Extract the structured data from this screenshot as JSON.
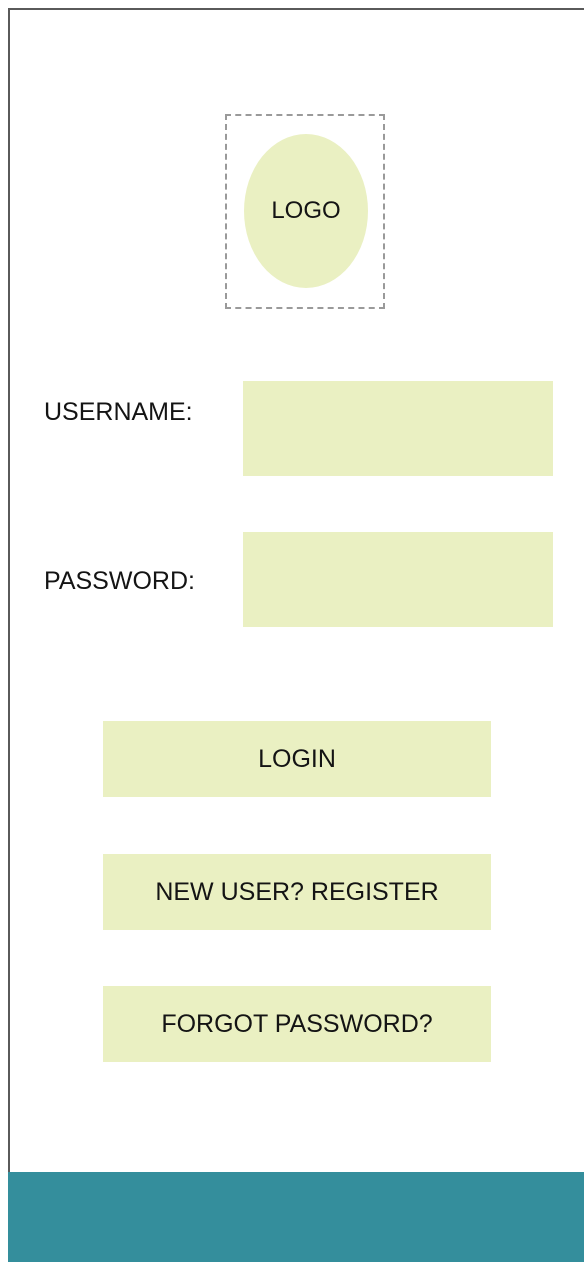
{
  "logo": {
    "text": "LOGO"
  },
  "form": {
    "username_label": "USERNAME:",
    "username_value": "",
    "password_label": "PASSWORD:",
    "password_value": ""
  },
  "actions": {
    "login_label": "LOGIN",
    "register_label": "NEW USER? REGISTER",
    "forgot_label": "FORGOT PASSWORD?"
  },
  "colors": {
    "field_fill": "#eaf0c2",
    "footer_bar": "#348e9c",
    "logo_placeholder_border": "#9a9a9a"
  }
}
